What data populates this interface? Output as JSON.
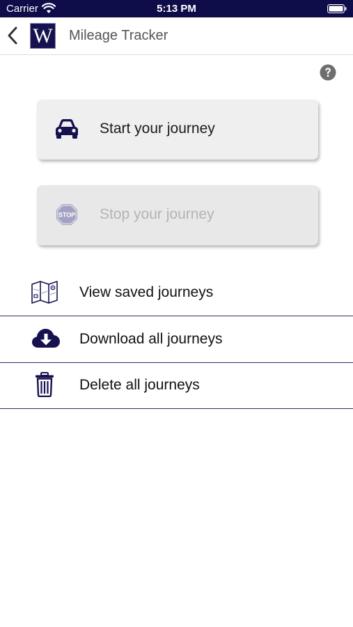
{
  "status_bar": {
    "carrier": "Carrier",
    "time": "5:13 PM"
  },
  "nav": {
    "logo_letter": "W",
    "title": "Mileage Tracker"
  },
  "actions": {
    "start_label": "Start your journey",
    "stop_label": "Stop your journey",
    "stop_icon_text": "STOP"
  },
  "menu": {
    "items": [
      {
        "label": "View saved journeys",
        "icon": "map-icon"
      },
      {
        "label": "Download all journeys",
        "icon": "cloud-download-icon"
      },
      {
        "label": "Delete all journeys",
        "icon": "trash-icon"
      }
    ]
  },
  "colors": {
    "primary": "#15124f",
    "status_bar": "#0f0c4a",
    "button_bg": "#efefef",
    "disabled_text": "#b4b4b4",
    "divider": "#2c2a66"
  }
}
